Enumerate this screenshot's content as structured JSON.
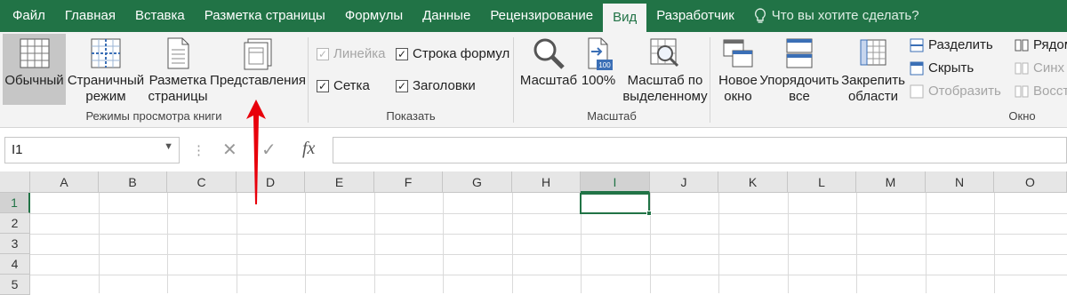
{
  "tabs": [
    "Файл",
    "Главная",
    "Вставка",
    "Разметка страницы",
    "Формулы",
    "Данные",
    "Рецензирование",
    "Вид",
    "Разработчик"
  ],
  "tell_me": "Что вы хотите сделать?",
  "groups": {
    "views": {
      "label": "Режимы просмотра книги",
      "normal": "Обычный",
      "page_break_1": "Страничный",
      "page_break_2": "режим",
      "page_layout_1": "Разметка",
      "page_layout_2": "страницы",
      "custom_views": "Представления"
    },
    "show": {
      "label": "Показать",
      "ruler": "Линейка",
      "formula_bar": "Строка формул",
      "gridlines": "Сетка",
      "headings": "Заголовки"
    },
    "zoom": {
      "label": "Масштаб",
      "zoom": "Масштаб",
      "zoom100": "100%",
      "zoom100_icon": "100",
      "zoom_sel_1": "Масштаб по",
      "zoom_sel_2": "выделенному"
    },
    "window": {
      "label": "Окно",
      "new_window_1": "Новое",
      "new_window_2": "окно",
      "arrange_1": "Упорядочить",
      "arrange_2": "все",
      "freeze_1": "Закрепить",
      "freeze_2": "области",
      "split": "Разделить",
      "hide": "Скрыть",
      "unhide": "Отобразить",
      "side_by_side": "Рядом",
      "sync": "Синх",
      "reset": "Восст"
    }
  },
  "formula_bar": {
    "name_box": "I1",
    "fx": "fx",
    "cancel": "✕",
    "enter": "✓"
  },
  "columns": [
    "A",
    "B",
    "C",
    "D",
    "E",
    "F",
    "G",
    "H",
    "I",
    "J",
    "K",
    "L",
    "M",
    "N",
    "O"
  ],
  "rows": [
    "1",
    "2",
    "3",
    "4",
    "5"
  ],
  "colors": {
    "accent": "#217346",
    "arrow": "#e8000b"
  }
}
